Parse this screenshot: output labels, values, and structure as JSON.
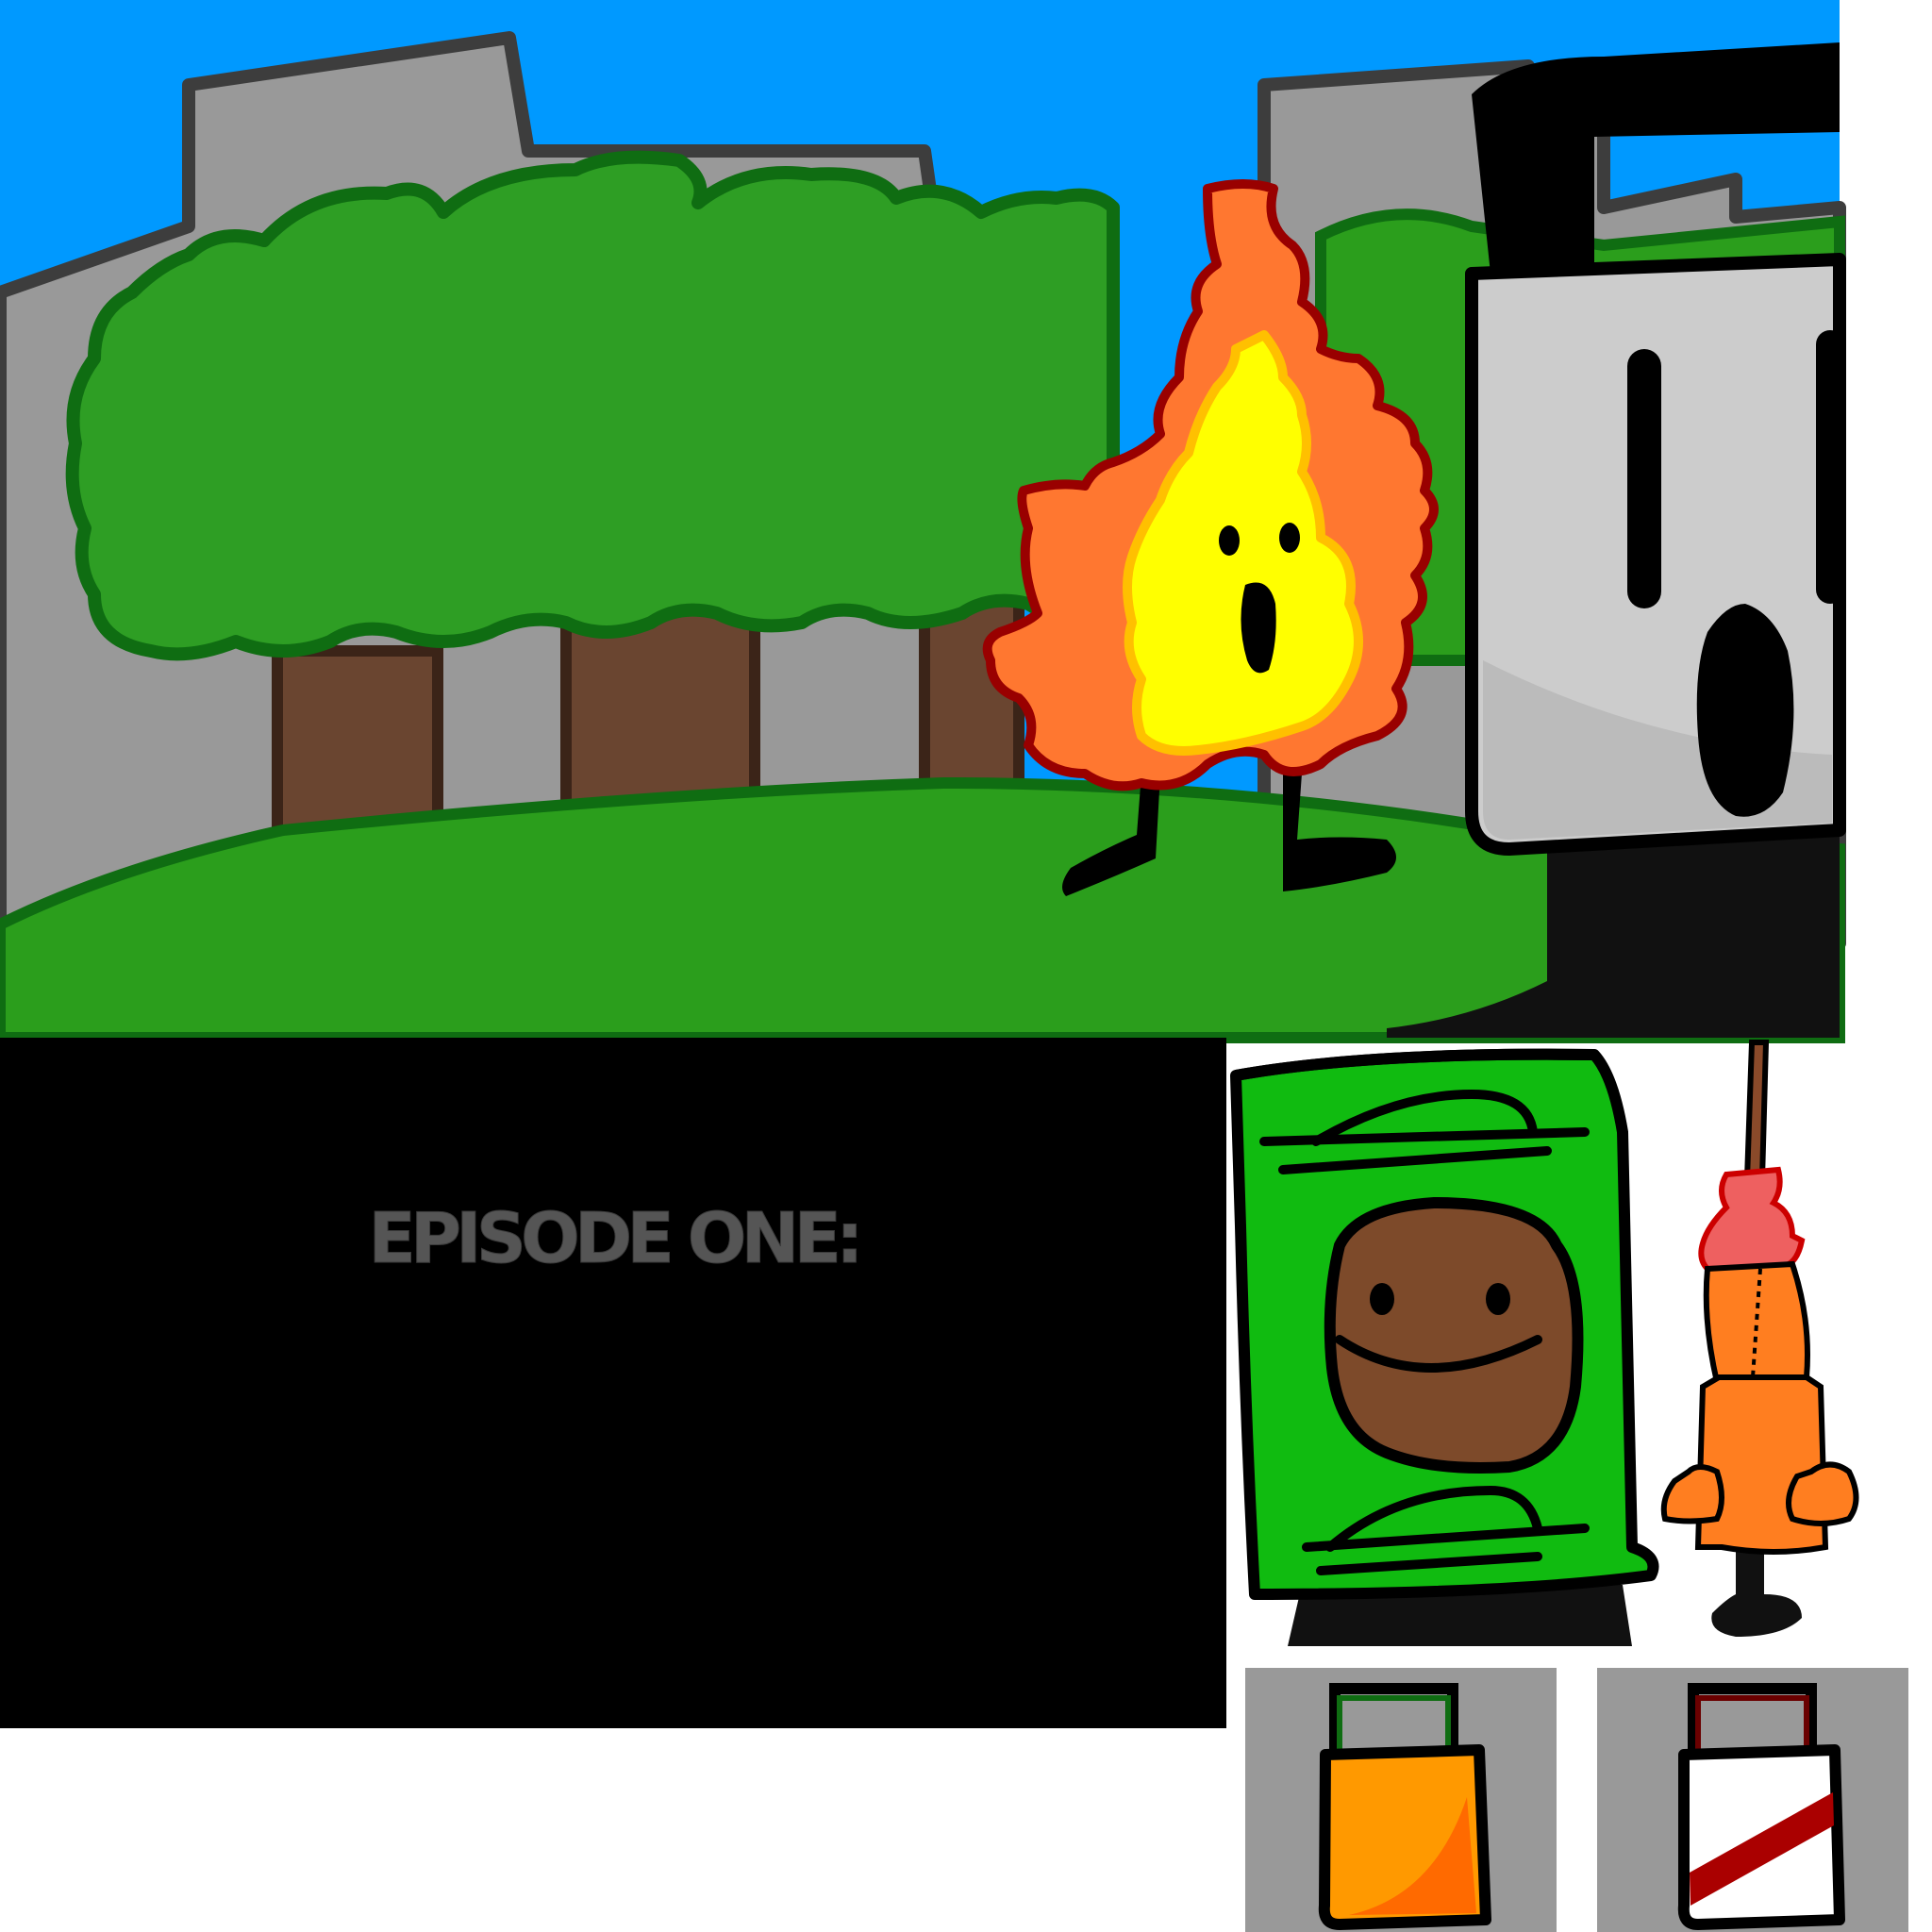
{
  "title_card": {
    "text": "EPISODE ONE:"
  },
  "palette": {
    "sky": "#0099ff",
    "building": "#999999",
    "building_outline": "#3d3d3d",
    "bush": "#2e9e24",
    "bush_outline": "#0f6d12",
    "trunk": "#6a4530",
    "ground": "#2b9e1c",
    "fire_outer": "#ff7730",
    "fire_outline": "#990000",
    "fire_inner": "#ffff00",
    "fire_inner_outline": "#ffc000",
    "block_face": "#cccccc",
    "block_dark": "#000000",
    "book_green": "#10bb10",
    "book_face": "#7d4a2a",
    "match_orange": "#ff7e20",
    "match_head": "#ee6060",
    "matchstick": "#8a4a2a",
    "tile_bg": "#999999",
    "orange_bag": "#ff9900",
    "red_stripe": "#aa0000",
    "title_card_bg": "#000000",
    "title_text": "#555555"
  },
  "icons": {
    "scene": "park-scene",
    "character_fire": "fire-character",
    "character_block": "gray-block-character",
    "character_book": "green-book-character",
    "character_match": "match-character",
    "prop_orange_bag": "orange-bag-icon",
    "prop_striped_bag": "striped-bag-icon"
  }
}
